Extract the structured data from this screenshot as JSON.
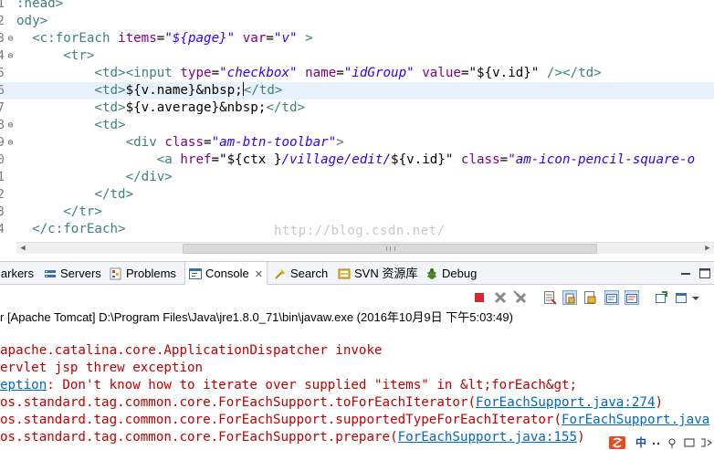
{
  "editor": {
    "lines": [
      {
        "ln": "1",
        "code": [
          {
            "t": "tag",
            "s": ":head>"
          }
        ]
      },
      {
        "ln": "2",
        "code": [
          {
            "t": "tag",
            "s": "ody>"
          }
        ]
      },
      {
        "ln": "3",
        "fold": "⊖",
        "code": [
          {
            "t": "plain",
            "s": "  "
          },
          {
            "t": "tag",
            "s": "<c:forEach "
          },
          {
            "t": "attr",
            "s": "items"
          },
          {
            "t": "plain",
            "s": "="
          },
          {
            "t": "val",
            "s": "\"${page}\""
          },
          {
            "t": "plain",
            "s": " "
          },
          {
            "t": "attr",
            "s": "var"
          },
          {
            "t": "plain",
            "s": "="
          },
          {
            "t": "val",
            "s": "\"v\""
          },
          {
            "t": "plain",
            "s": " "
          },
          {
            "t": "tag",
            "s": ">"
          }
        ]
      },
      {
        "ln": "4",
        "fold": "⊖",
        "code": [
          {
            "t": "plain",
            "s": "      "
          },
          {
            "t": "tag",
            "s": "<tr>"
          }
        ]
      },
      {
        "ln": "5",
        "code": [
          {
            "t": "plain",
            "s": "          "
          },
          {
            "t": "tag",
            "s": "<td><input "
          },
          {
            "t": "attr",
            "s": "type"
          },
          {
            "t": "plain",
            "s": "="
          },
          {
            "t": "val",
            "s": "\"checkbox\""
          },
          {
            "t": "plain",
            "s": " "
          },
          {
            "t": "attr",
            "s": "name"
          },
          {
            "t": "plain",
            "s": "="
          },
          {
            "t": "val",
            "s": "\"idGroup\""
          },
          {
            "t": "plain",
            "s": " "
          },
          {
            "t": "attr",
            "s": "value"
          },
          {
            "t": "plain",
            "s": "="
          },
          {
            "t": "ent",
            "s": "\"${v.id}\""
          },
          {
            "t": "plain",
            "s": " "
          },
          {
            "t": "tag",
            "s": "/></td>"
          }
        ]
      },
      {
        "ln": "6",
        "current": true,
        "code": [
          {
            "t": "plain",
            "s": "          "
          },
          {
            "t": "tag",
            "s": "<td>"
          },
          {
            "t": "ent",
            "s": "${v.name}&nbsp;"
          },
          {
            "t": "caret",
            "s": ""
          },
          {
            "t": "tag",
            "s": "</td>"
          }
        ]
      },
      {
        "ln": "7",
        "code": [
          {
            "t": "plain",
            "s": "          "
          },
          {
            "t": "tag",
            "s": "<td>"
          },
          {
            "t": "ent",
            "s": "${v.average}&nbsp;"
          },
          {
            "t": "tag",
            "s": "</td>"
          }
        ]
      },
      {
        "ln": "8",
        "fold": "⊖",
        "code": [
          {
            "t": "plain",
            "s": "          "
          },
          {
            "t": "tag",
            "s": "<td>"
          }
        ]
      },
      {
        "ln": "9",
        "fold": "⊖",
        "code": [
          {
            "t": "plain",
            "s": "              "
          },
          {
            "t": "tag",
            "s": "<div "
          },
          {
            "t": "attr",
            "s": "class"
          },
          {
            "t": "plain",
            "s": "="
          },
          {
            "t": "val",
            "s": "\"am-btn-toolbar\""
          },
          {
            "t": "tag",
            "s": ">"
          }
        ]
      },
      {
        "ln": "0",
        "code": [
          {
            "t": "plain",
            "s": "                  "
          },
          {
            "t": "tag",
            "s": "<a "
          },
          {
            "t": "attr",
            "s": "href"
          },
          {
            "t": "plain",
            "s": "="
          },
          {
            "t": "ent",
            "s": "\"${ctx }"
          },
          {
            "t": "val",
            "s": "/village/edit/"
          },
          {
            "t": "ent",
            "s": "${v.id}\""
          },
          {
            "t": "plain",
            "s": " "
          },
          {
            "t": "attr",
            "s": "class"
          },
          {
            "t": "plain",
            "s": "="
          },
          {
            "t": "val",
            "s": "\"am-icon-pencil-square-o"
          }
        ]
      },
      {
        "ln": "1",
        "code": [
          {
            "t": "plain",
            "s": "              "
          },
          {
            "t": "tag",
            "s": "</div>"
          }
        ]
      },
      {
        "ln": "2",
        "code": [
          {
            "t": "plain",
            "s": "          "
          },
          {
            "t": "tag",
            "s": "</td>"
          }
        ]
      },
      {
        "ln": "3",
        "code": [
          {
            "t": "plain",
            "s": "      "
          },
          {
            "t": "tag",
            "s": "</tr>"
          }
        ]
      },
      {
        "ln": "4",
        "code": [
          {
            "t": "plain",
            "s": "  "
          },
          {
            "t": "tag",
            "s": "</c:forEach>"
          }
        ]
      }
    ],
    "watermark": "http://blog.csdn.net/"
  },
  "tabs": {
    "markers": "larkers",
    "servers": "Servers",
    "problems": "Problems",
    "console": "Console",
    "console_close": "✕",
    "search": "Search",
    "svn": "SVN 资源库",
    "debug": "Debug"
  },
  "console": {
    "header": "r [Apache Tomcat] D:\\Program Files\\Java\\jre1.8.0_71\\bin\\javaw.exe (2016年10月9日 下午5:03:49)",
    "lines": [
      {
        "parts": [
          {
            "t": "err",
            "s": "apache.catalina.core.ApplicationDispatcher invoke"
          }
        ]
      },
      {
        "parts": [
          {
            "t": "err",
            "s": "ervlet jsp threw exception"
          }
        ]
      },
      {
        "parts": [
          {
            "t": "link",
            "s": "eption"
          },
          {
            "t": "err",
            "s": ": Don't know how to iterate over supplied \"items\" in &lt;forEach&gt;"
          }
        ]
      },
      {
        "parts": [
          {
            "t": "err",
            "s": "os.standard.tag.common.core.ForEachSupport.toForEachIterator("
          },
          {
            "t": "link",
            "s": "ForEachSupport.java:274"
          },
          {
            "t": "err",
            "s": ")"
          }
        ]
      },
      {
        "parts": [
          {
            "t": "err",
            "s": "os.standard.tag.common.core.ForEachSupport.supportedTypeForEachIterator("
          },
          {
            "t": "link",
            "s": "ForEachSupport.java"
          }
        ]
      },
      {
        "parts": [
          {
            "t": "err",
            "s": "os.standard.tag.common.core.ForEachSupport.prepare("
          },
          {
            "t": "link",
            "s": "ForEachSupport.java:155"
          },
          {
            "t": "err",
            "s": ")"
          }
        ]
      }
    ]
  },
  "ime": {
    "label": "中"
  },
  "colors": {
    "tag": "#3f7f7f",
    "attr": "#7f007f",
    "value": "#2a00ff",
    "error": "#c00000",
    "link": "#0066cc"
  }
}
